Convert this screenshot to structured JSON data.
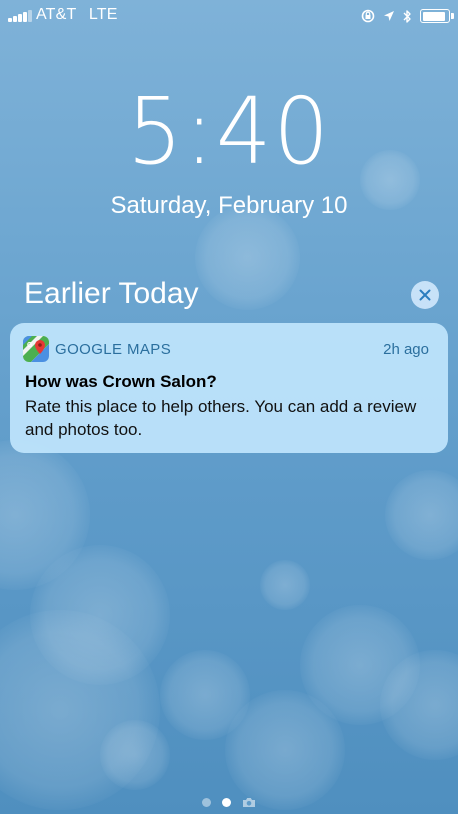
{
  "status_bar": {
    "carrier": "AT&T",
    "network": "LTE",
    "battery_level": 0.92,
    "icons": [
      "signal-bars-icon",
      "orientation-lock-icon",
      "location-arrow-icon",
      "bluetooth-icon",
      "battery-icon"
    ]
  },
  "lock_screen": {
    "time": "5:40",
    "date": "Saturday, February 10"
  },
  "notifications": {
    "section_title": "Earlier Today",
    "clear_icon": "close-icon",
    "items": [
      {
        "app_name": "GOOGLE MAPS",
        "app_icon": "google-maps-icon",
        "time_ago": "2h ago",
        "title": "How was Crown Salon?",
        "body": "Rate this place to help others. You can add a review and photos too."
      }
    ]
  },
  "page_indicator": {
    "icons": [
      "page-dot-icon",
      "page-dot-active-icon",
      "camera-icon"
    ]
  },
  "colors": {
    "accent": "#2b6f9e",
    "notification_bg": "#c4e8ff",
    "clear_button_bg": "#d7ecff"
  }
}
